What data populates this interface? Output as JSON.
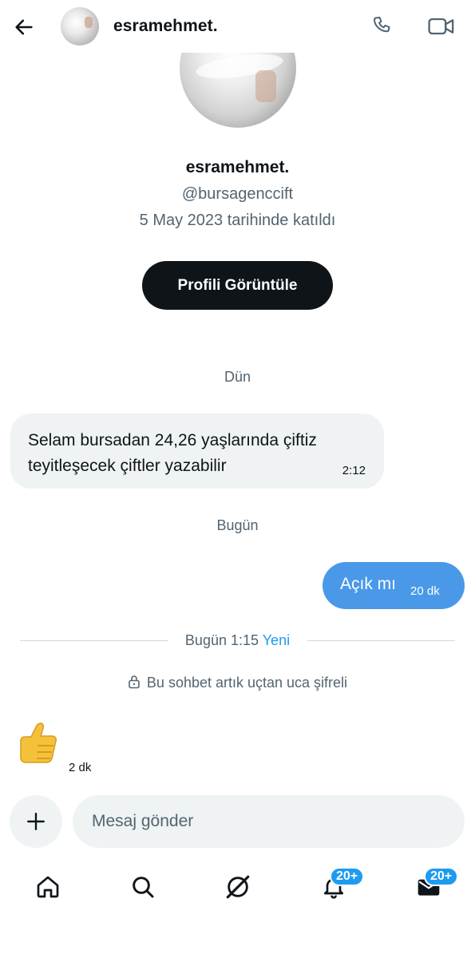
{
  "header": {
    "username": "esramehmet.",
    "icons": {
      "back": "back-arrow-icon",
      "call": "phone-icon",
      "video": "video-camera-icon"
    }
  },
  "profile": {
    "name": "esramehmet.",
    "handle": "@bursagenccift",
    "joined": "5 May 2023 tarihinde katıldı",
    "view_profile_button": "Profili Görüntüle"
  },
  "conversation": {
    "day_yesterday": "Dün",
    "incoming_message": {
      "text": "Selam bursadan 24,26 yaşlarında çiftiz teyitleşecek çiftler yazabilir",
      "time": "2:12"
    },
    "day_today": "Bugün",
    "outgoing_message": {
      "text": "Açık mı",
      "time": "20 dk"
    },
    "divider": {
      "time": "Bugün 1:15",
      "new_label": "Yeni"
    },
    "encryption_notice": "Bu sohbet artık uçtan uca şifreli",
    "reaction": {
      "emoji": "👍",
      "time": "2 dk"
    }
  },
  "composer": {
    "placeholder": "Mesaj gönder",
    "add_icon": "plus-icon"
  },
  "bottom_nav": {
    "items": [
      {
        "name": "home",
        "icon": "home-icon"
      },
      {
        "name": "search",
        "icon": "search-icon"
      },
      {
        "name": "grok",
        "icon": "grok-icon"
      },
      {
        "name": "notifications",
        "icon": "bell-icon",
        "badge": "20+"
      },
      {
        "name": "messages",
        "icon": "envelope-icon",
        "badge": "20+"
      }
    ]
  },
  "colors": {
    "accent": "#1d9bf0",
    "outgoing_bubble": "#4a99e9",
    "incoming_bubble": "#eff3f4",
    "text_secondary": "#536471"
  }
}
